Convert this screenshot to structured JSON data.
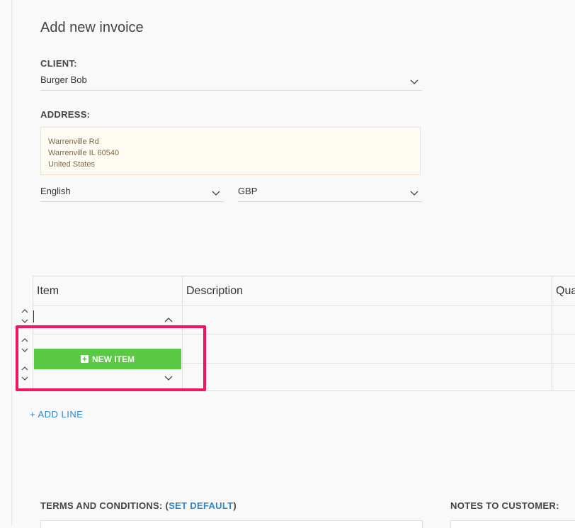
{
  "page": {
    "title": "Add new invoice"
  },
  "client": {
    "label": "CLIENT:",
    "value": "Burger Bob"
  },
  "address": {
    "label": "ADDRESS:",
    "lines": [
      "Warrenville Rd",
      "Warrenville IL 60540",
      "United States"
    ]
  },
  "language": {
    "value": "English"
  },
  "currency": {
    "value": "GBP"
  },
  "table": {
    "headers": {
      "item": "Item",
      "description": "Description",
      "quantity": "Qua"
    },
    "new_item_label": "NEW ITEM"
  },
  "add_line": {
    "label": "+ ADD LINE"
  },
  "terms": {
    "label": "TERMS AND CONDITIONS: (",
    "link": "SET DEFAULT",
    "close": ")"
  },
  "notes": {
    "label": "NOTES TO CUSTOMER:"
  },
  "colors": {
    "accent_link": "#2f86d0",
    "new_item_green": "#5cc945",
    "highlight_pink": "#f0175a"
  },
  "icons": [
    "chevron-down-icon",
    "chevron-up-icon",
    "plus-square-icon"
  ]
}
